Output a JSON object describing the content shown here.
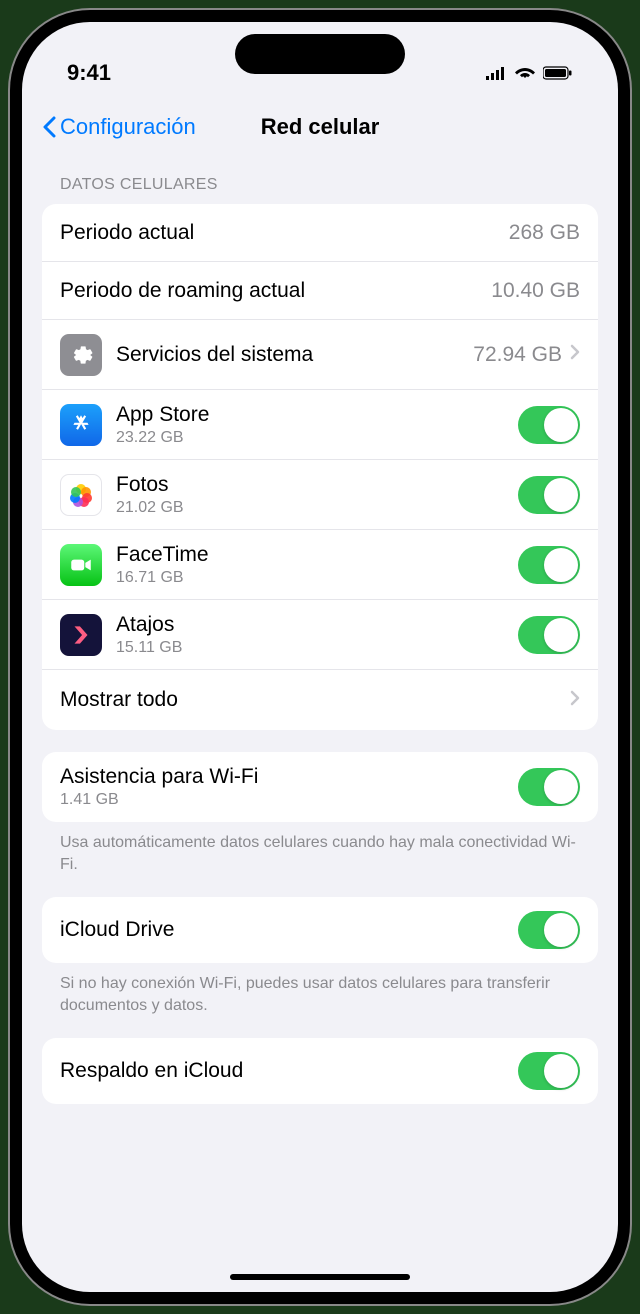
{
  "statusBar": {
    "time": "9:41"
  },
  "nav": {
    "back": "Configuración",
    "title": "Red celular"
  },
  "sectionHeader": "DATOS CELULARES",
  "usage": {
    "currentPeriodLabel": "Periodo actual",
    "currentPeriodValue": "268 GB",
    "roamingLabel": "Periodo de roaming actual",
    "roamingValue": "10.40 GB",
    "systemServicesLabel": "Servicios del sistema",
    "systemServicesValue": "72.94 GB"
  },
  "apps": [
    {
      "name": "App Store",
      "sub": "23.22 GB"
    },
    {
      "name": "Fotos",
      "sub": "21.02 GB"
    },
    {
      "name": "FaceTime",
      "sub": "16.71 GB"
    },
    {
      "name": "Atajos",
      "sub": "15.11 GB"
    }
  ],
  "showAll": "Mostrar todo",
  "wifiAssist": {
    "label": "Asistencia para Wi-Fi",
    "sub": "1.41 GB",
    "footer": "Usa automáticamente datos celulares cuando hay mala conectividad Wi-Fi."
  },
  "icloudDrive": {
    "label": "iCloud Drive",
    "footer": "Si no hay conexión Wi-Fi, puedes usar datos celulares para transferir documentos y datos."
  },
  "icloudBackup": {
    "label": "Respaldo en iCloud"
  }
}
